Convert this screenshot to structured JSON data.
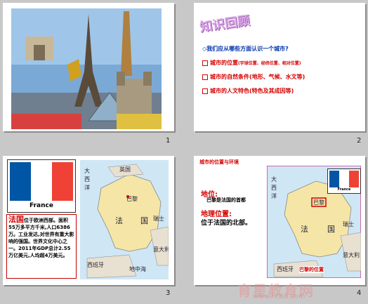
{
  "slides": [
    {
      "number": "1"
    },
    {
      "number": "2",
      "title": "知识回顾",
      "question": "◇我们应从哪些方面认识一个城市?",
      "items": [
        {
          "main": "城市的位置",
          "note": "(宇球位置、经纬位置、相对位置)"
        },
        {
          "main": "城市的自然条件(地形、气候、水文等)",
          "note": ""
        },
        {
          "main": "城市的人文特色(特色及其成因等)",
          "note": ""
        }
      ]
    },
    {
      "number": "3",
      "flag_caption": "France",
      "info_head": "法国",
      "info_text": "位于欧洲西部。面积55万多平方千米,人口6386万。工业发达,对世界有重大影响的强国。世界文化中心之一。2011年GDP总计2.55万亿美元,人均超4万美元。",
      "map_labels": [
        "大",
        "西",
        "洋",
        "英国",
        "巴黎",
        "法",
        "国",
        "西班牙",
        "地中海",
        "意大利",
        "瑞士"
      ]
    },
    {
      "number": "4",
      "header": "城市的位置与环境",
      "label1": "地位:",
      "text1": "巴黎是法国的首都",
      "label2": "地理位置:",
      "text2": "位于法国的北部。",
      "flag_caption": "France",
      "map_caption": "巴黎的位置",
      "map_labels": [
        "大",
        "西",
        "洋",
        "巴黎",
        "法",
        "国",
        "西班牙",
        "意大利",
        "瑞士"
      ]
    }
  ],
  "watermark": {
    "main": "育星教育网",
    "sub": "www.ht88.com"
  },
  "colors": {
    "red": "#d40000",
    "blue": "#0033aa",
    "france_blue": "#0055a4",
    "france_red": "#ef4135"
  }
}
